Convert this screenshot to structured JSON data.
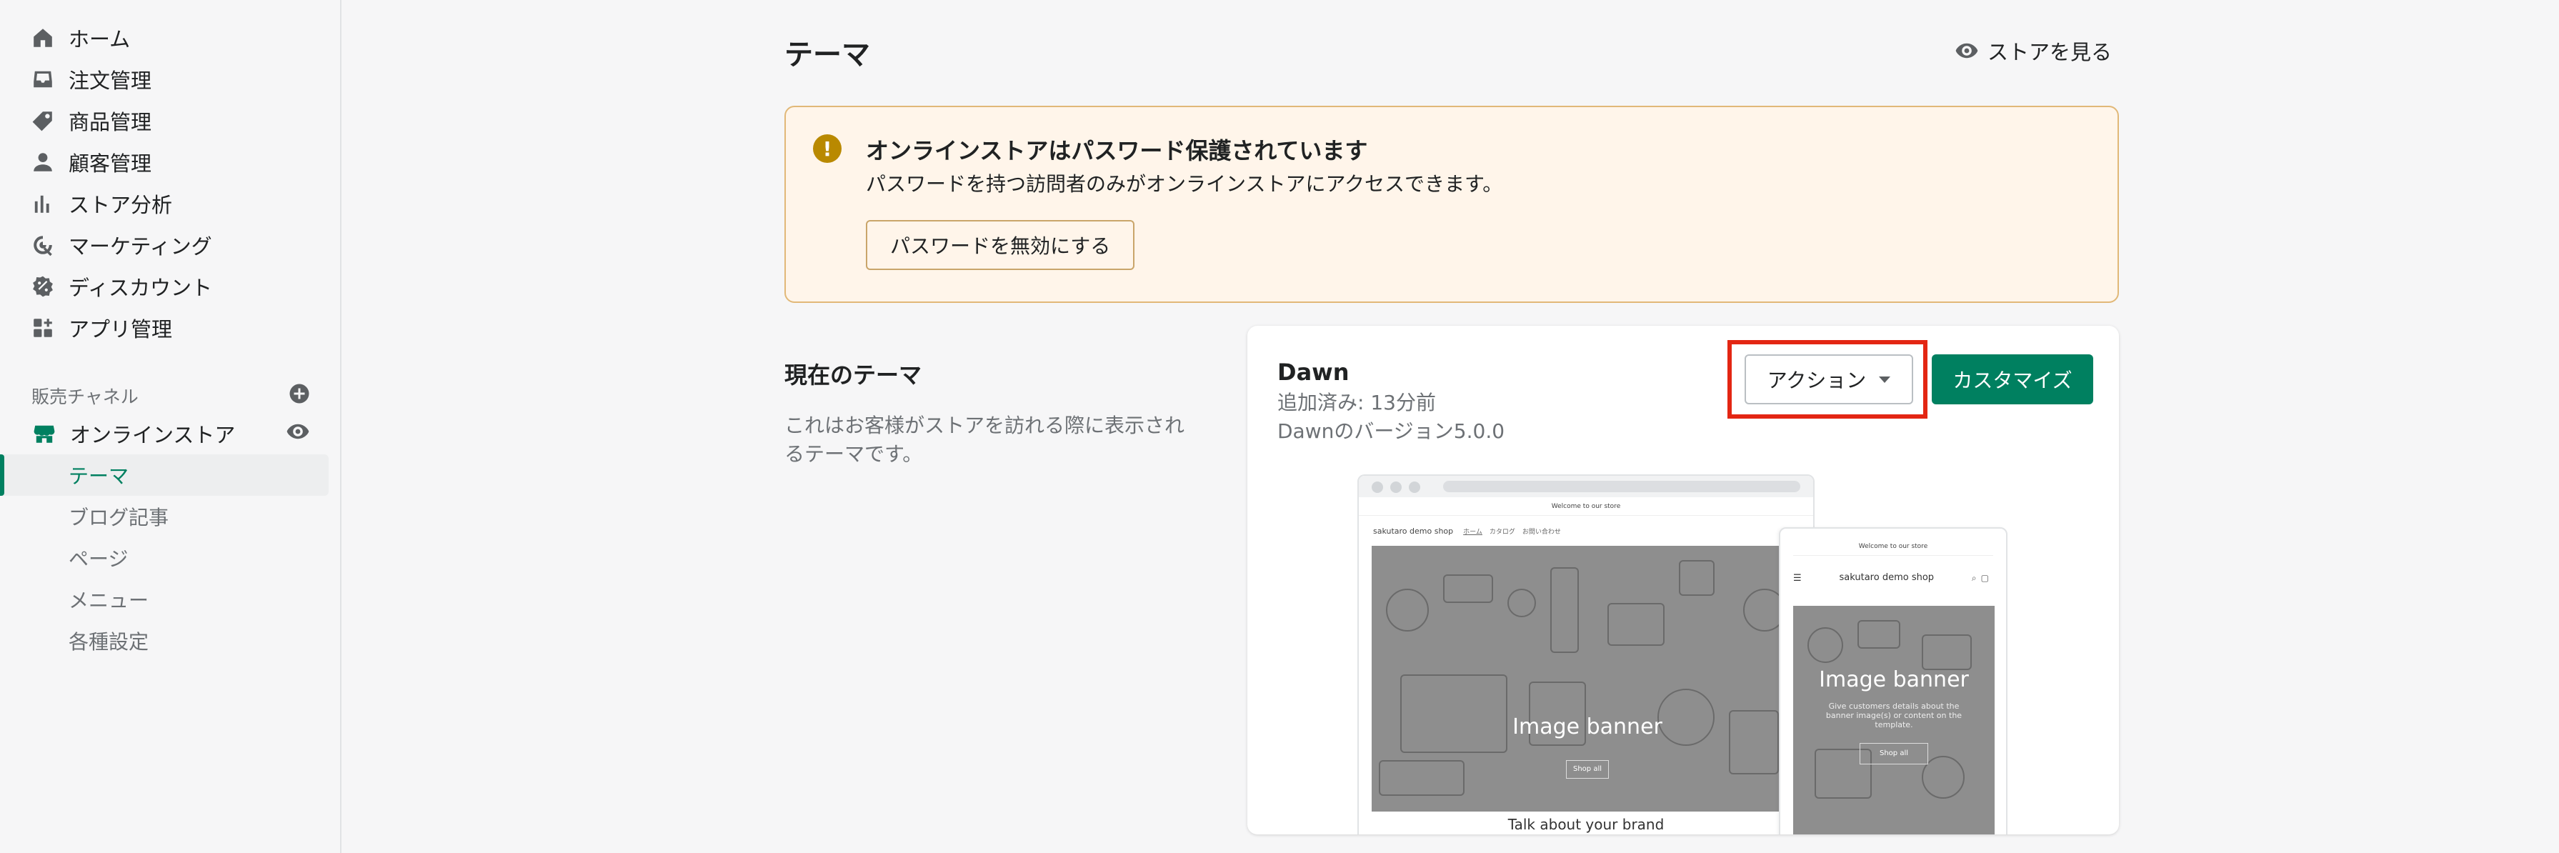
{
  "sidebar": {
    "items": [
      {
        "label": "ホーム",
        "icon": "home-icon"
      },
      {
        "label": "注文管理",
        "icon": "inbox-icon"
      },
      {
        "label": "商品管理",
        "icon": "tag-icon"
      },
      {
        "label": "顧客管理",
        "icon": "person-icon"
      },
      {
        "label": "ストア分析",
        "icon": "bar-chart-icon"
      },
      {
        "label": "マーケティング",
        "icon": "target-icon"
      },
      {
        "label": "ディスカウント",
        "icon": "discount-icon"
      },
      {
        "label": "アプリ管理",
        "icon": "apps-icon"
      }
    ],
    "sales_channels_label": "販売チャネル",
    "online_store_label": "オンラインストア",
    "sub_items": [
      "テーマ",
      "ブログ記事",
      "ページ",
      "メニュー",
      "各種設定"
    ],
    "active_sub_item": "テーマ"
  },
  "header": {
    "title": "テーマ",
    "view_store_label": "ストアを見る"
  },
  "banner": {
    "title": "オンラインストアはパスワード保護されています",
    "message": "パスワードを持つ訪問者のみがオンラインストアにアクセスできます。",
    "button_label": "パスワードを無効にする",
    "icon": "warning-icon"
  },
  "current_theme": {
    "section_title": "現在のテーマ",
    "section_description": "これはお客様がストアを訪れる際に表示されるテーマです。",
    "name": "Dawn",
    "added": "追加済み: 13分前",
    "version": "Dawnのバージョン5.0.0",
    "actions_label": "アクション",
    "customize_label": "カスタマイズ"
  },
  "preview": {
    "announcement": "Welcome to our store",
    "shop_name": "sakutaro demo shop",
    "desktop_nav": [
      "ホーム",
      "カタログ",
      "お問い合わせ"
    ],
    "hero_title": "Image banner",
    "hero_subtitle": "Give customers details about the banner image(s) or content on the template.",
    "hero_button": "Shop all",
    "footer_text": "Talk about your brand"
  },
  "colors": {
    "accent": "#008060",
    "highlight": "#e32613",
    "banner_bg": "#fff5ea",
    "banner_border": "#e1b878"
  }
}
